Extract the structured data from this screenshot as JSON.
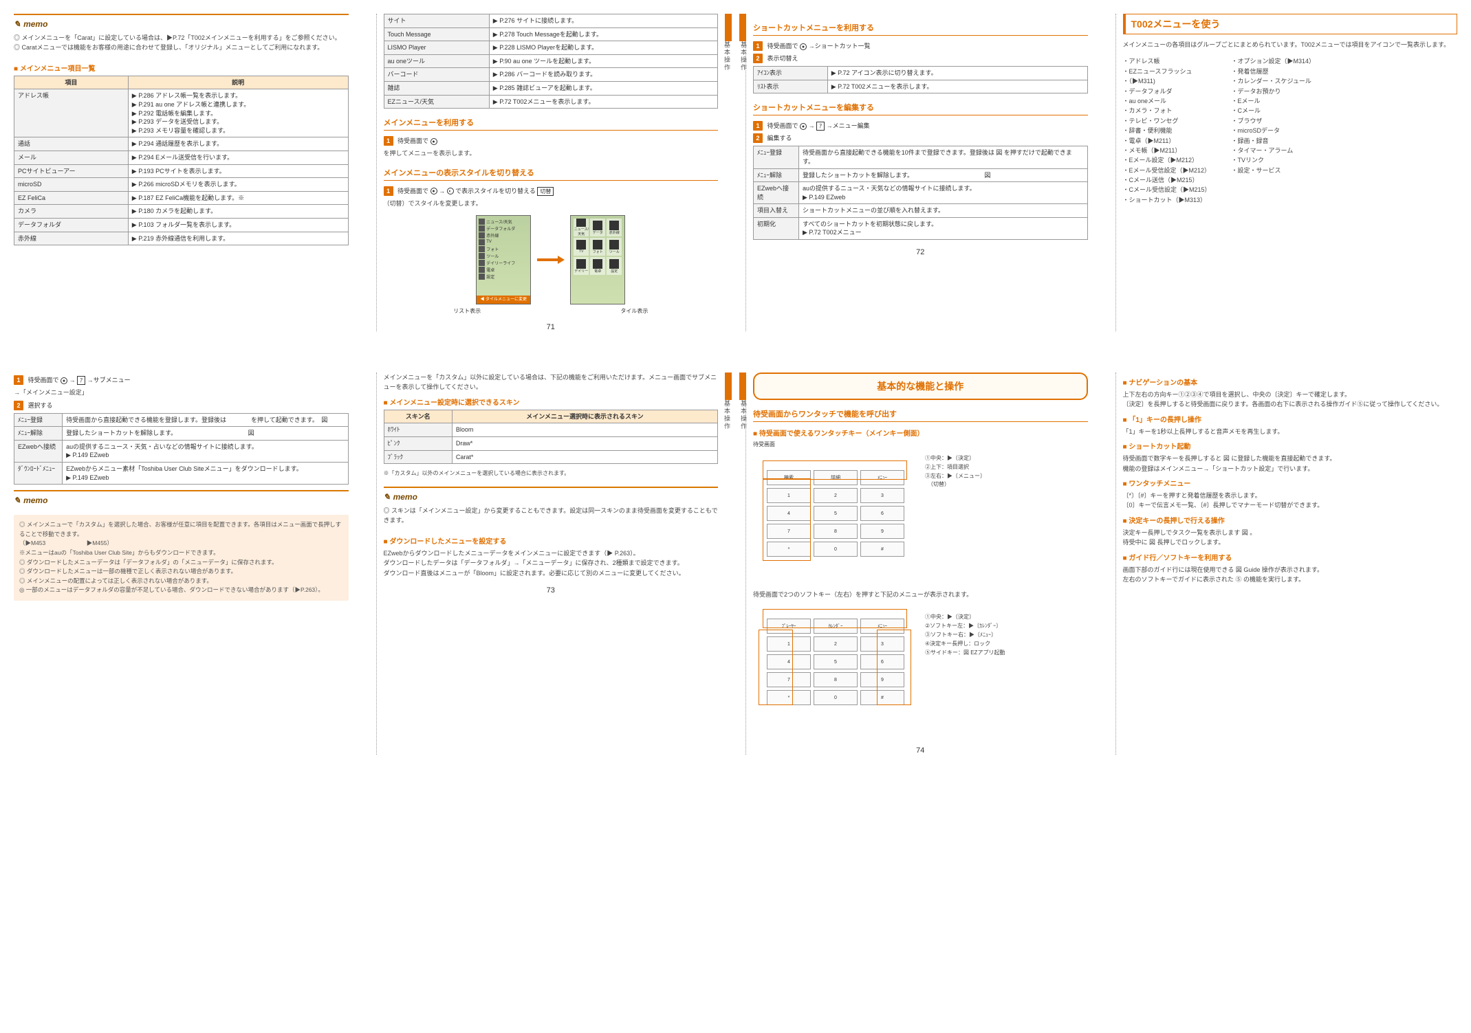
{
  "memoLabel": "memo",
  "p71": {
    "memo1": "◎ メインメニューを「Carat」に設定している場合は、▶P.72「T002メインメニューを利用する」をご参照ください。\n◎ Caratメニューでは機能をお客様の用途に合わせて登録し、「オリジナル」メニューとしてご利用になれます。",
    "tableTitle": "メインメニュー項目一覧",
    "headers": [
      "項目",
      "説明"
    ],
    "rows": [
      [
        "アドレス帳",
        "▶ P.286 アドレス帳一覧を表示します。\n▶ P.291 au one アドレス帳と連携します。\n▶ P.292 電話帳を編集します。\n▶ P.293 データを送受信します。\n▶ P.293 メモリ容量を確認します。"
      ],
      [
        "通話",
        "▶ P.294 通話履歴を表示します。"
      ],
      [
        "メール ",
        "▶ P.294 Eメール送受信を行います。"
      ],
      [
        "PCサイトビューアー",
        "▶ P.193 PCサイトを表示します。"
      ],
      [
        "microSD",
        "▶ P.266 microSDメモリを表示します。"
      ],
      [
        "EZ FeliCa",
        "▶ P.187 EZ FeliCa機能を起動します。※"
      ],
      [
        "カメラ     ",
        "▶ P.180 カメラを起動します。"
      ],
      [
        "データフォルダ",
        "▶ P.103 フォルダ一覧を表示します。"
      ],
      [
        "赤外線    ",
        "▶ P.219 赤外線通信を利用します。"
      ]
    ],
    "rows2": [
      [
        "サイト",
        "▶ P.276 サイトに接続します。"
      ],
      [
        "Touch Message",
        "▶ P.278 Touch Messageを起動します。"
      ],
      [
        "LISMO Player",
        "▶ P.228 LISMO Playerを起動します。"
      ],
      [
        "au oneツール",
        "▶ P.90 au one ツールを起動します。"
      ],
      [
        "バーコード",
        "▶ P.286 バーコードを読み取ります。"
      ],
      [
        "雑誌",
        "▶ P.285 雑誌ビューアを起動します。"
      ],
      [
        "EZニュース/天気",
        "▶ P.72 T002メニューを表示します。"
      ]
    ],
    "hd1": "メインメニューを利用する",
    "step1a": "待受画面で",
    "step1b": "を押してメニューを表示します。",
    "hd2": "メインメニューの表示スタイルを切り替える",
    "step2a": "待受画面で",
    "step2b": "→",
    "step2c": "で表示スタイルを切り替える",
    "step2d": "（切替）でスタイルを変更します。",
    "cap1": "リスト表示",
    "cap2": "タイル表示",
    "menuRows": [
      "ニュース/天気",
      "データフォルダ",
      "赤外線",
      "TV",
      "フォト",
      "ツール",
      "デイリーライフ",
      "電卓",
      "設定"
    ],
    "menuTiles": [
      "ニュース/天気",
      "データ",
      "赤外線",
      "TV",
      "フォト",
      "ツール",
      "デイリー",
      "電卓",
      "設定"
    ],
    "titleBar": "◀ タイルメニューに変更"
  },
  "p72": {
    "sideLabel": "基本操作",
    "hd1": "ショートカットメニューを利用する",
    "s1a": "待受画面で",
    "s1b": "→ショートカット一覧",
    "s2a": "表示切替え",
    "s2rows": [
      [
        "ｱｲｺﾝ表示",
        "▶ P.72 アイコン表示に切り替えます。"
      ],
      [
        "ﾘｽﾄ表示   ",
        "▶ P.72 T002メニューを表示します。"
      ]
    ],
    "hd2": "ショートカットメニューを編集する",
    "s3a": "待受画面で",
    "s3b": "→",
    "s3c": "→メニュー編集",
    "s4": "編集する",
    "edRows": [
      [
        "ﾒﾆｭｰ登録",
        "待受画面から直接起動できる機能を10件まで登録できます。登録後は 図 を押すだけで起動できます。"
      ],
      [
        "ﾒﾆｭｰ解除",
        "登録したショートカットを解除します。　　　　　　　　　　　　図"
      ],
      [
        "EZwebへ接続",
        "auの提供するニュース・天気などの情報サイトに接続します。\n▶ P.149 EZweb"
      ],
      [
        "項目入替え ",
        "ショートカットメニューの並び順を入れ替えます。"
      ],
      [
        "初期化     ",
        "すべてのショートカットを初期状態に戻します。\n▶ P.72 T002メニュー"
      ]
    ],
    "t002Title": "T002メニューを使う",
    "t002Intro": "メインメニューの各項目はグループごとにまとめられています。T002メニューでは項目をアイコンで一覧表示します。",
    "colL": [
      "アドレス帳",
      "EZニュースフラッシュ",
      "（▶M311)",
      "データフォルダ",
      "au oneメール",
      "カメラ・フォト",
      "テレビ・ワンセグ",
      "辞書・便利機能",
      "電卓（▶M211）",
      "メモ帳（▶M211）",
      "Eメール設定（▶M212）",
      "Eメール受信設定（▶M212）",
      "Cメール送信（▶M215）",
      "Cメール受信設定（▶M215）",
      "ショートカット（▶M313）"
    ],
    "colR": [
      "オプション設定（▶M314）",
      "発着信履歴",
      "カレンダー・スケジュール",
      "データお預かり",
      "Eメール",
      "Cメール",
      "ブラウザ",
      "microSDデータ",
      "録画・録音",
      "タイマー・アラーム",
      "TVリンク",
      "設定・サービス"
    ]
  },
  "p73": {
    "s1a": "待受画面で",
    "s1b": "→",
    "s1c": "→サブメニュー",
    "s1d": "→「メインメニュー設定」",
    "s2": "選択する",
    "edRows": [
      [
        "ﾒﾆｭｰ登録 ",
        "待受画面から直接起動できる機能を登録します。登録後は　　　　を押して起動できます。　図"
      ],
      [
        "ﾒﾆｭｰ解除 ",
        "登録したショートカットを解除します。　　　　　　　　　　　　図"
      ],
      [
        "EZwebへ接続 ",
        "auの提供するニュース・天気・占いなどの情報サイトに接続します。\n▶ P.149 EZweb"
      ],
      [
        "ﾀﾞｳﾝﾛｰﾄﾞﾒﾆｭｰ",
        "EZwebからメニュー素材「Toshiba User Club Siteメニュー」をダウンロードします。\n▶ P.149 EZweb"
      ]
    ],
    "memoA": "◎ メインメニューで「カスタム」を選択した場合、お客様が任意に項目を配置できます。各項目はメニュー画面で長押しすることで移動できます。\n（▶M453　　　　　　　▶M455）\n※メニューはauの「Toshiba User Club Site」からもダウンロードできます。\n◎ ダウンロードしたメニューデータは「データフォルダ」の「メニューデータ」に保存されます。\n◎ ダウンロードしたメニューは一部の機種で正しく表示されない場合があります。\n◎ メインメニューの配置によっては正しく表示されない場合があります。\n◎ 一部のメニューはデータフォルダの容量が不足している場合、ダウンロードできない場合があります（▶P.263）。",
    "rNote": "メインメニューを「カスタム」以外に設定している場合は、下記の機能をご利用いただけます。メニュー画面でサブメニューを表示して操作してください。",
    "rHd": "メインメニュー設定時に選択できるスキン",
    "rTh1": "スキン名",
    "rTh2": "メインメニュー選択時に表示されるスキン",
    "rRows": [
      [
        "ﾎﾜｲﾄ",
        "Bloom"
      ],
      [
        "ﾋﾟﾝｸ  ",
        "Draw*"
      ],
      [
        "ﾌﾞﾗｯｸ",
        "Carat*"
      ]
    ],
    "rFoot": "※「カスタム」以外のメインメニューを選択している場合に表示されます。",
    "memoB": "◎ スキンは「メインメニュー設定」から変更することもできます。設定は同一スキンのまま待受画面を変更することもできます。",
    "rHd2": "ダウンロードしたメニューを設定する",
    "rPara": "EZwebからダウンロードしたメニューデータをメインメニューに設定できます（▶ P.263）。\nダウンロードしたデータは「データフォルダ」→「メニューデータ」に保存され、2種類まで設定できます。\nダウンロード直後はメニューが「Bloom」に設定されます。必要に応じて別のメニューに変更してください。"
  },
  "p74": {
    "chapter": "基本的な機能と操作",
    "hd1": "待受画面からワンタッチで機能を呼び出す",
    "hd2": "待受画面で使えるワンタッチキー（メインキー側面）",
    "kpLeft": "待受画面",
    "kpRows1": [
      "検索",
      "詳細",
      "ﾒﾆｭｰ",
      "1",
      "2",
      "3",
      "4",
      "5",
      "6",
      "7",
      "8",
      "9",
      "*",
      "0",
      "#"
    ],
    "sideLabel": "基本操作",
    "cap1": [
      "①中央：▶〔決定〕",
      "②上下：項目選択",
      "③左右：▶〔メニュー〕",
      "　（切替）"
    ],
    "cap2note": "待受画面で2つのソフトキー（左右）を押すと下記のメニューが表示されます。",
    "kpRows2": [
      "ﾌﾟﾚｰﾔｰ",
      "ｶﾚﾝﾀﾞｰ",
      "ﾒﾆｭｰ",
      "1",
      "2",
      "3",
      "4",
      "5",
      "6",
      "7",
      "8",
      "9",
      "*",
      "0",
      "#"
    ],
    "cap2": [
      "①中央：▶〔決定〕",
      "②ソフトキー左：▶〔ｶﾚﾝﾀﾞｰ〕",
      "③ソフトキー右：▶〔ﾒﾆｭｰ〕",
      "④決定キー長押し：ロック",
      "⑤サイドキー：図 EZアプリ起動"
    ],
    "rHd1": "ナビゲーションの基本",
    "rP1": "上下左右の方向キー①②③④で項目を選択し、中央の〔決定〕キーで確定します。\n〔決定〕を長押しすると待受画面に戻ります。各画面の右下に表示される操作ガイド⑤に従って操作してください。",
    "rHd2": "「1」キーの長押し操作",
    "rP2": "「1」キーを1秒以上長押しすると音声メモを再生します。",
    "rHd3": "ショートカット起動",
    "rP3": "待受画面で数字キーを長押しすると 図 に登録した機能を直接起動できます。\n機能の登録はメインメニュー→「ショートカット設定」で行います。",
    "rHd4": "ワンタッチメニュー",
    "rP4": "〔*〕〔#〕キーを押すと発着信履歴を表示します。\n〔0〕キーで伝言メモ一覧、〔#〕長押しでマナーモード切替ができます。",
    "rHd5": "決定キーの長押しで行える操作",
    "rP5": "決定キー長押しでタスク一覧を表示します 図 。\n待受中に 図 長押しでロックします。",
    "rHd6": "ガイド行／ソフトキーを利用する",
    "rP6": "画面下部のガイド行には現在使用できる 図 Guide 操作が表示されます。\n左右のソフトキーでガイドに表示された ⑤ の機能を実行します。"
  },
  "pagenos": [
    "71",
    "72",
    "73",
    "74"
  ]
}
